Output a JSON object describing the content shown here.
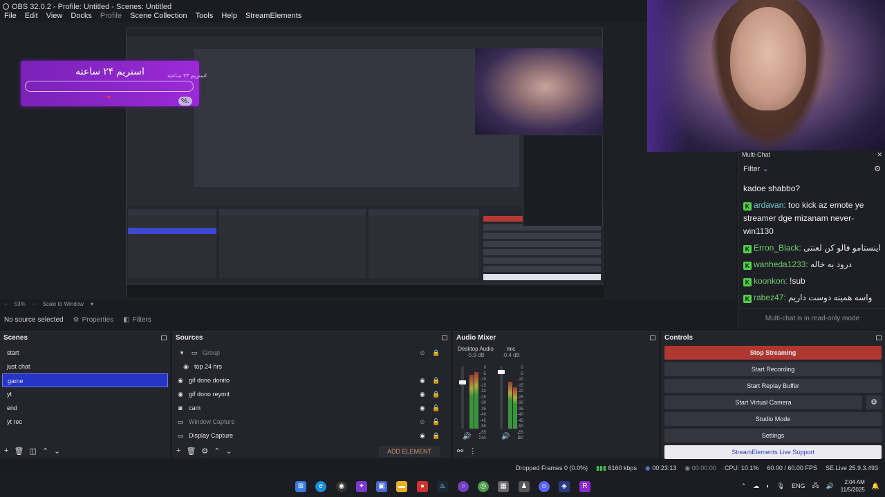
{
  "window": {
    "title": "OBS 32.0.2 - Profile: Untitled - Scenes: Untitled"
  },
  "menu": [
    "File",
    "Edit",
    "View",
    "Docks",
    "Profile",
    "Scene Collection",
    "Tools",
    "Help",
    "StreamElements"
  ],
  "overlay": {
    "title": "استریم ۲۴ ساعته",
    "subtitle": "استریم ۲۴ ساعته",
    "percent": "%.",
    "heart": "♥"
  },
  "multichat": {
    "title": "Multi-Chat",
    "filter_label": "Filter",
    "messages": [
      {
        "user": "",
        "text": "kadoe shabbo?",
        "badge": false
      },
      {
        "user": "ardavan:",
        "text": " too kick az emote ye streamer dge mizanam never-win1130",
        "badge": true,
        "color": "#6fd0d0"
      },
      {
        "user": "Erron_Black:",
        "text": " اینستامو فالو کن لعنتی",
        "badge": true,
        "color": "#6fcf6f"
      },
      {
        "user": "wanheda1233:",
        "text": " درود به خاله",
        "badge": true,
        "color": "#6fcf6f"
      },
      {
        "user": "koonkon:",
        "text": " !sub",
        "badge": true,
        "color": "#6fcf6f"
      },
      {
        "user": "rabez47:",
        "text": " واسه همینه دوست داریم",
        "badge": true,
        "color": "#6fcf6f"
      }
    ],
    "footer": "Multi-chat is in read-only mode"
  },
  "scalebar": {
    "zoom": "53%",
    "mode": "Scale to Window"
  },
  "infobar": {
    "status": "No source selected",
    "properties": "Properties",
    "filters": "Filters"
  },
  "scenes": {
    "title": "Scenes",
    "items": [
      "start",
      "just chat",
      "game",
      "yt",
      "end",
      "yt rec"
    ],
    "selected": "game"
  },
  "sources": {
    "title": "Sources",
    "items": [
      {
        "name": "Group",
        "icon": "folder-icon",
        "dim": true
      },
      {
        "name": "top 24 hrs",
        "icon": "browser-icon",
        "dim": false
      },
      {
        "name": "gif dono donito",
        "icon": "browser-icon",
        "dim": false
      },
      {
        "name": "gif dono reymit",
        "icon": "browser-icon",
        "dim": false
      },
      {
        "name": "cam",
        "icon": "camera-icon",
        "dim": false
      },
      {
        "name": "Window Capture",
        "icon": "window-icon",
        "dim": true
      },
      {
        "name": "Display Capture",
        "icon": "monitor-icon",
        "dim": false
      }
    ],
    "add_element": "ADD ELEMENT"
  },
  "mixer": {
    "title": "Audio Mixer",
    "channels": [
      {
        "name": "Desktop Audio",
        "db": "-5.9 dB"
      },
      {
        "name": "mic",
        "db": "-0.4 dB"
      }
    ],
    "ticks": [
      "0",
      "-5",
      "-10",
      "-15",
      "-20",
      "-25",
      "-30",
      "-35",
      "-40",
      "-45",
      "-50",
      "-55",
      "-60"
    ]
  },
  "controls": {
    "title": "Controls",
    "buttons": [
      "Stop Streaming",
      "Start Recording",
      "Start Replay Buffer",
      "Start Virtual Camera",
      "Studio Mode",
      "Settings",
      "StreamElements Live Support"
    ]
  },
  "status": {
    "dropped": "Dropped Frames 0 (0.0%)",
    "kbps": "6160 kbps",
    "stream_time": "00:23:13",
    "rec_time": "00:00:00",
    "cpu": "CPU: 10.1%",
    "fps": "60.00 / 60.00 FPS",
    "version": "SE.Live 25.9.3.493"
  },
  "taskbar": {
    "lang": "ENG",
    "time": "2:04 AM",
    "date": "11/5/2025"
  },
  "colors": {
    "accent_blue": "#2435c8",
    "stop_red": "#b0372f",
    "kick_green": "#53d04a"
  }
}
